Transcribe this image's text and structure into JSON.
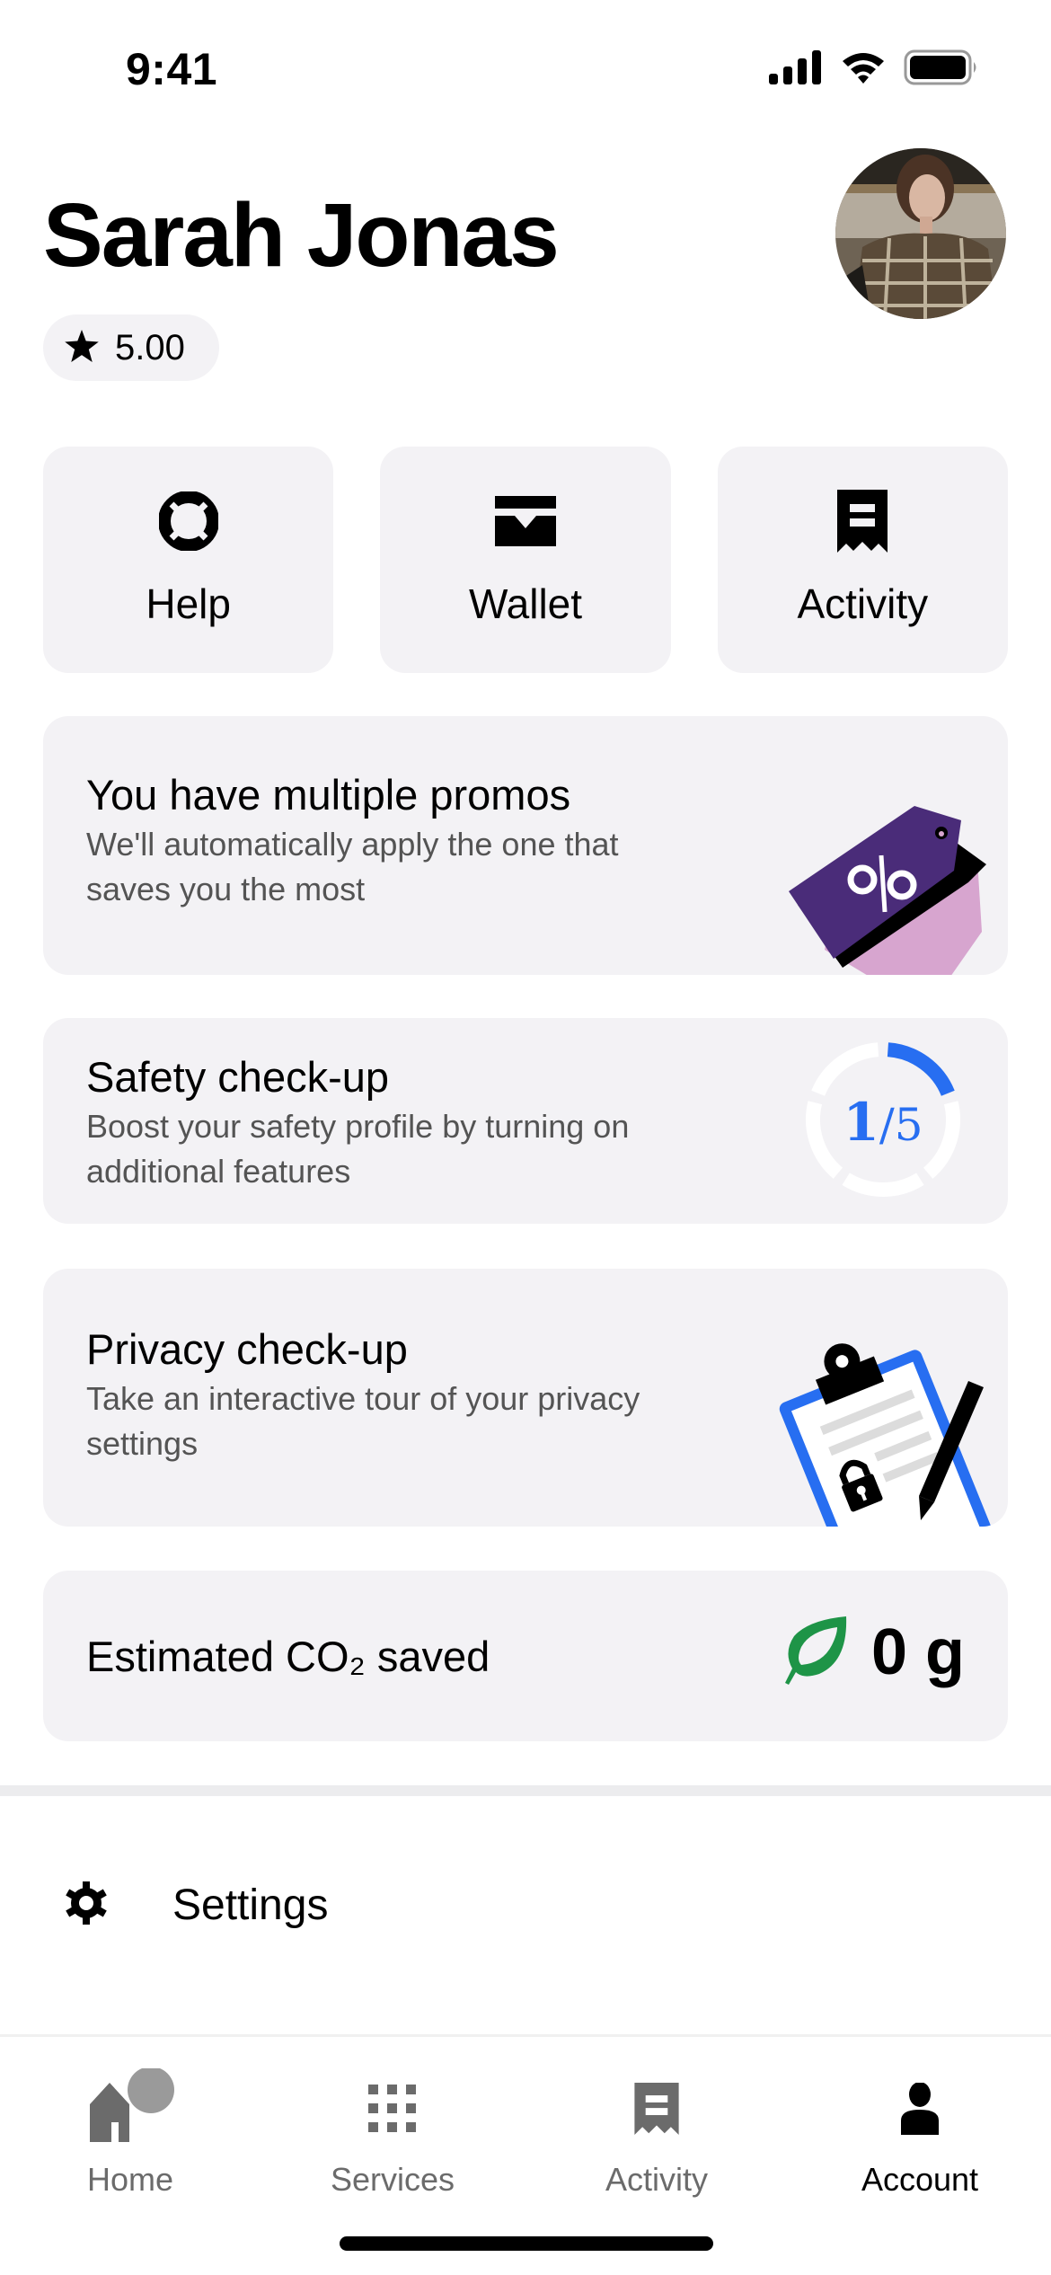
{
  "status_bar": {
    "time": "9:41",
    "icons": [
      "cellular-signal-icon",
      "wifi-icon",
      "battery-icon"
    ]
  },
  "profile": {
    "name": "Sarah Jonas",
    "rating": "5.00",
    "rating_icon": "star-icon",
    "avatar_alt": "Profile photo"
  },
  "quick_actions": [
    {
      "label": "Help",
      "icon": "lifebuoy-icon"
    },
    {
      "label": "Wallet",
      "icon": "wallet-icon"
    },
    {
      "label": "Activity",
      "icon": "receipt-icon"
    }
  ],
  "cards": {
    "promos": {
      "title": "You have multiple promos",
      "description": "We'll automatically apply the one that saves you the most",
      "illustration": "promo-tag-illustration"
    },
    "safety": {
      "title": "Safety check-up",
      "description": "Boost your safety profile by turning on additional features",
      "progress_completed": 1,
      "progress_total": 5,
      "progress_label_num": "1",
      "progress_label_den": "/5"
    },
    "privacy": {
      "title": "Privacy check-up",
      "description": "Take an interactive tour of your privacy settings",
      "illustration": "clipboard-lock-illustration"
    },
    "co2": {
      "label": "Estimated CO₂ saved",
      "value": "0 g",
      "icon": "leaf-icon"
    }
  },
  "settings": {
    "label": "Settings",
    "icon": "gear-icon"
  },
  "tab_bar": {
    "tabs": [
      {
        "label": "Home",
        "icon": "home-icon",
        "active": false
      },
      {
        "label": "Services",
        "icon": "grid-icon",
        "active": false
      },
      {
        "label": "Activity",
        "icon": "receipt-icon",
        "active": false
      },
      {
        "label": "Account",
        "icon": "person-icon",
        "active": true
      }
    ]
  },
  "colors": {
    "accent_blue": "#276EF1",
    "card_bg": "#F3F2F5",
    "promo_purple": "#4A2C79",
    "promo_pink": "#D7A5CF",
    "leaf_green": "#1E9447",
    "inactive_tab": "#6B6B6B"
  }
}
